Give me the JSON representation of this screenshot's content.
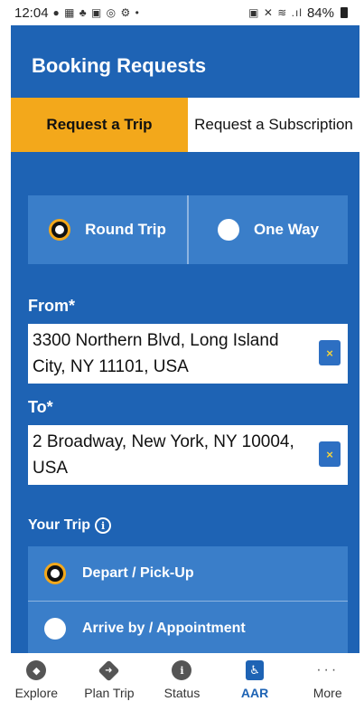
{
  "status_bar": {
    "time": "12:04",
    "left_icons": "● ▦ ♣ ▣ ◎ ⚙ •",
    "right_icons": "▣ ✕ ≋ .ıl",
    "battery": "84%"
  },
  "header": {
    "title": "Booking Requests"
  },
  "tabs": [
    {
      "label": "Request a Trip",
      "active": true
    },
    {
      "label": "Request a Subscription",
      "active": false
    }
  ],
  "trip_type": {
    "options": [
      {
        "label": "Round Trip",
        "selected": true
      },
      {
        "label": "One Way",
        "selected": false
      }
    ]
  },
  "from": {
    "label": "From*",
    "value": "3300 Northern Blvd, Long Island City, NY 11101, USA",
    "clear_label": "×"
  },
  "to": {
    "label": "To*",
    "value": "2 Broadway, New York, NY 10004, USA",
    "clear_label": "×"
  },
  "your_trip": {
    "label": "Your Trip",
    "info_glyph": "i",
    "options": [
      {
        "label": "Depart / Pick-Up",
        "selected": true
      },
      {
        "label": "Arrive by / Appointment",
        "selected": false
      }
    ]
  },
  "bottom_nav": [
    {
      "label": "Explore",
      "icon": "compass-icon",
      "active": false
    },
    {
      "label": "Plan Trip",
      "icon": "directions-icon",
      "active": false
    },
    {
      "label": "Status",
      "icon": "info-icon",
      "active": false
    },
    {
      "label": "AAR",
      "icon": "wheelchair-icon",
      "active": true
    },
    {
      "label": "More",
      "icon": "more-dots-icon",
      "active": false
    }
  ],
  "colors": {
    "primary_blue": "#1e63b4",
    "option_blue": "#3a7ec9",
    "accent_orange": "#f3a81b"
  }
}
